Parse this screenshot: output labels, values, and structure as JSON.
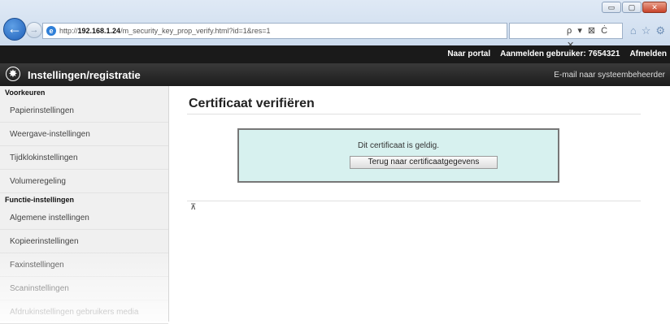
{
  "browser": {
    "url_prefix": "http://",
    "url_host": "192.168.1.24",
    "url_path": "/m_security_key_prop_verify.html?id=1&res=1",
    "search_symbol": "ρ ▾ ⊠ Ċ ✕",
    "window_buttons": [
      "▭",
      "▢",
      "✕"
    ],
    "toolbar_icons": [
      "⌂",
      "☆",
      "⚙"
    ]
  },
  "topbar": {
    "model": "",
    "portal": "Naar portal",
    "login_label": "Aanmelden gebruiker:",
    "user": "7654321",
    "logout": "Afmelden"
  },
  "titlebar": {
    "title": "Instellingen/registratie",
    "mail": "E-mail naar systeembeheerder"
  },
  "sidebar": {
    "sections": [
      {
        "heading": "Voorkeuren",
        "items": [
          "Papierinstellingen",
          "Weergave-instellingen",
          "Tijdklokinstellingen",
          "Volumeregeling"
        ]
      },
      {
        "heading": "Functie-instellingen",
        "items": [
          "Algemene instellingen",
          "Kopieerinstellingen",
          "Faxinstellingen",
          "Scaninstellingen",
          "Afdrukinstellingen gebruikers media"
        ]
      }
    ]
  },
  "main": {
    "title": "Certificaat verifiëren",
    "message": "Dit certificaat is geldig.",
    "back_button": "Terug naar certificaatgegevens",
    "top_link": "⊼"
  }
}
